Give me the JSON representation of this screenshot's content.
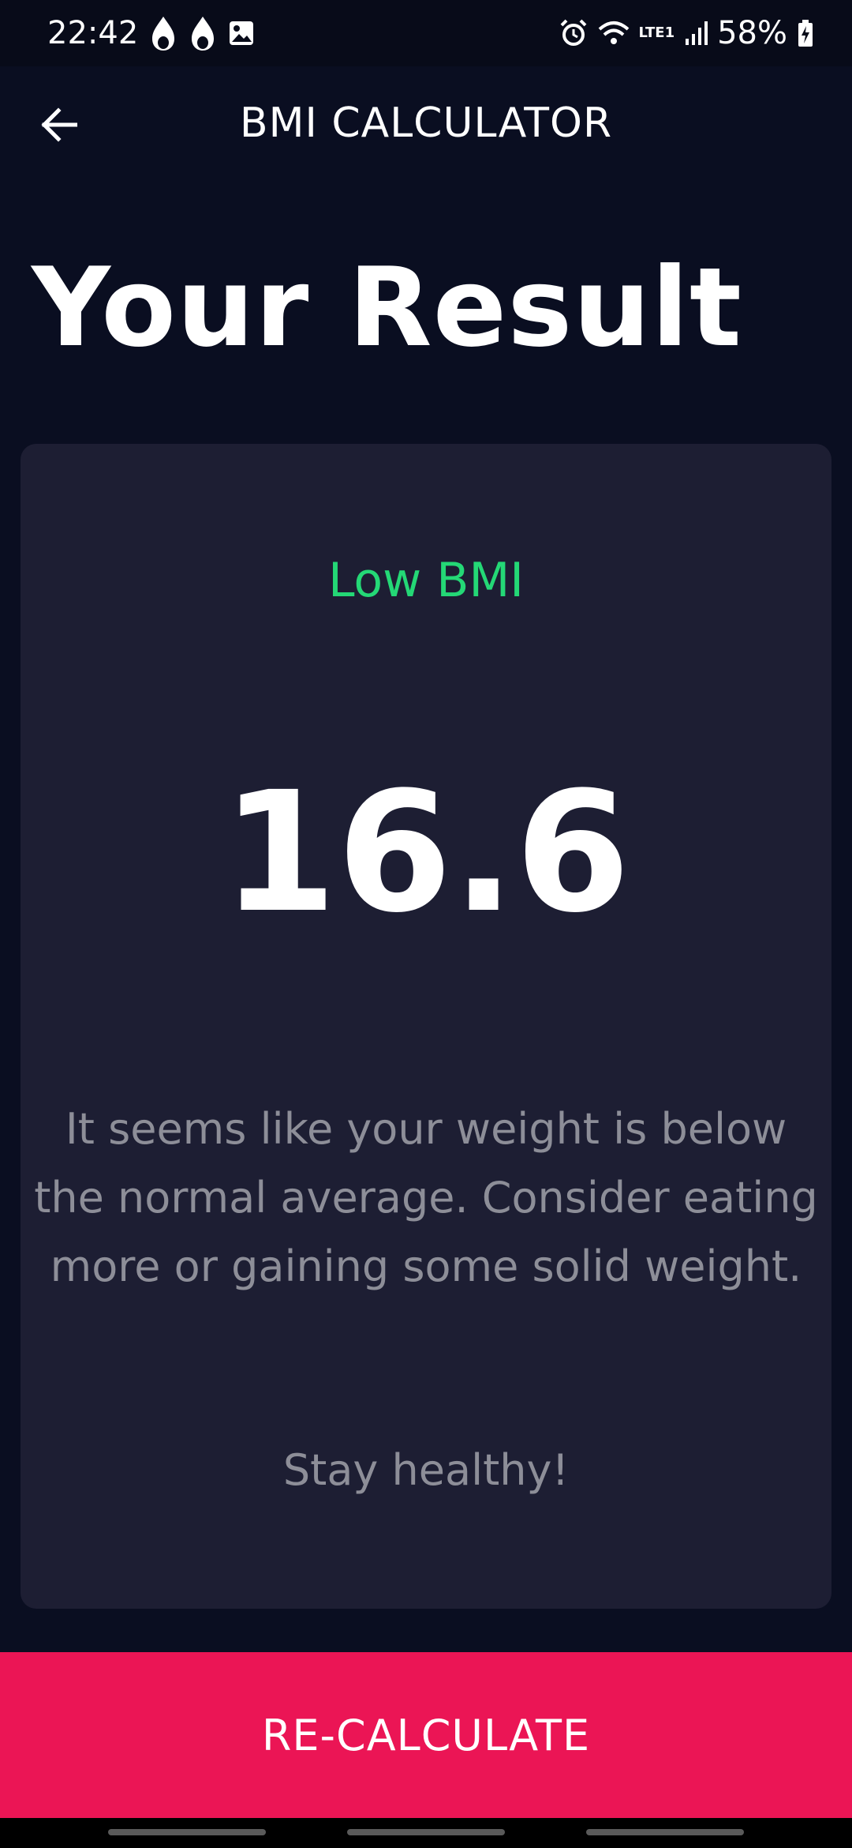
{
  "status_bar": {
    "time": "22:42",
    "network_label": "LTE1",
    "battery_percent": "58%"
  },
  "app_bar": {
    "title": "BMI CALCULATOR"
  },
  "page": {
    "title": "Your Result"
  },
  "result": {
    "status_label": "Low BMI",
    "bmi_value": "16.6",
    "message": "It seems like your weight is below the normal average. Consider eating more or gaining some solid weight.",
    "sign_off": "Stay healthy!"
  },
  "actions": {
    "recalculate_label": "RE-CALCULATE"
  },
  "colors": {
    "background": "#0a0e21",
    "card": "#1d1e33",
    "accent": "#eb1555",
    "status_low": "#24d876",
    "muted_text": "#8d8e98"
  },
  "icons": {
    "back": "arrow-left-icon",
    "notification_1": "flame-icon",
    "notification_2": "flame-icon",
    "notification_3": "image-icon",
    "alarm": "alarm-icon",
    "wifi": "wifi-icon",
    "signal": "signal-icon",
    "battery": "battery-charging-icon"
  }
}
